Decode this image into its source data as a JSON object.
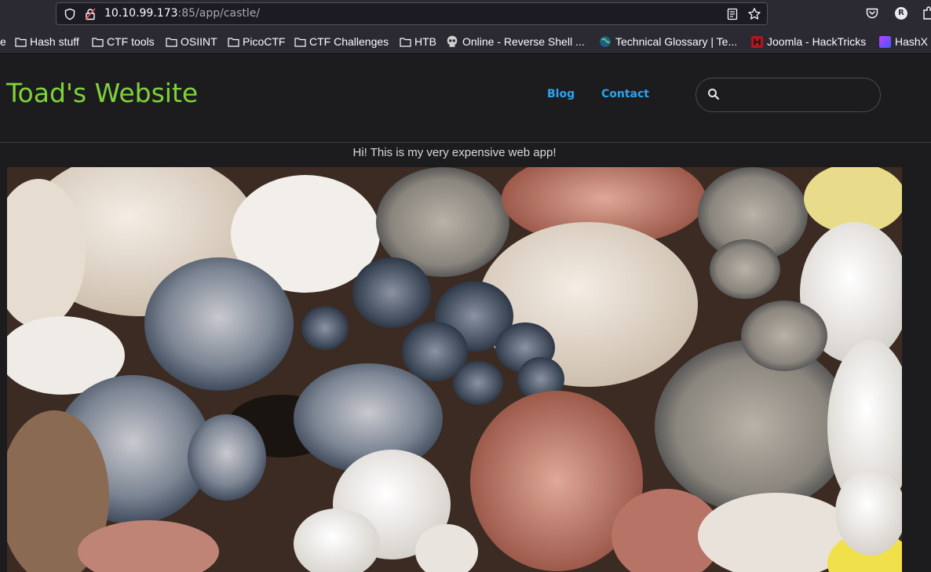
{
  "browser": {
    "url_host": "10.10.99.173",
    "url_rest": ":85/app/castle/",
    "profile_initial": "R",
    "bookmarks": [
      {
        "label": "Hash stuff",
        "icon": "folder-icon"
      },
      {
        "label": "CTF tools",
        "icon": "folder-icon"
      },
      {
        "label": "OSIINT",
        "icon": "folder-icon"
      },
      {
        "label": "PicoCTF",
        "icon": "folder-icon"
      },
      {
        "label": "CTF Challenges",
        "icon": "folder-icon"
      },
      {
        "label": "HTB",
        "icon": "folder-icon"
      },
      {
        "label": "Online - Reverse Shell ...",
        "icon": "skull-icon"
      },
      {
        "label": "Technical Glossary | Te...",
        "icon": "globe-icon"
      },
      {
        "label": "Joomla - HackTricks",
        "icon": "hacktricks-icon"
      },
      {
        "label": "HashX",
        "icon": "hashx-icon"
      }
    ]
  },
  "site": {
    "title": "Toad's Website",
    "nav": [
      {
        "label": "Blog"
      },
      {
        "label": "Contact"
      }
    ],
    "search": {
      "placeholder": "",
      "value": ""
    },
    "tagline": "Hi! This is my very expensive web app!",
    "colors": {
      "title": "#7ed33a",
      "links": "#2ea3ee",
      "background": "#1c1c1f"
    },
    "hero_image": "mushrooms-photo"
  }
}
